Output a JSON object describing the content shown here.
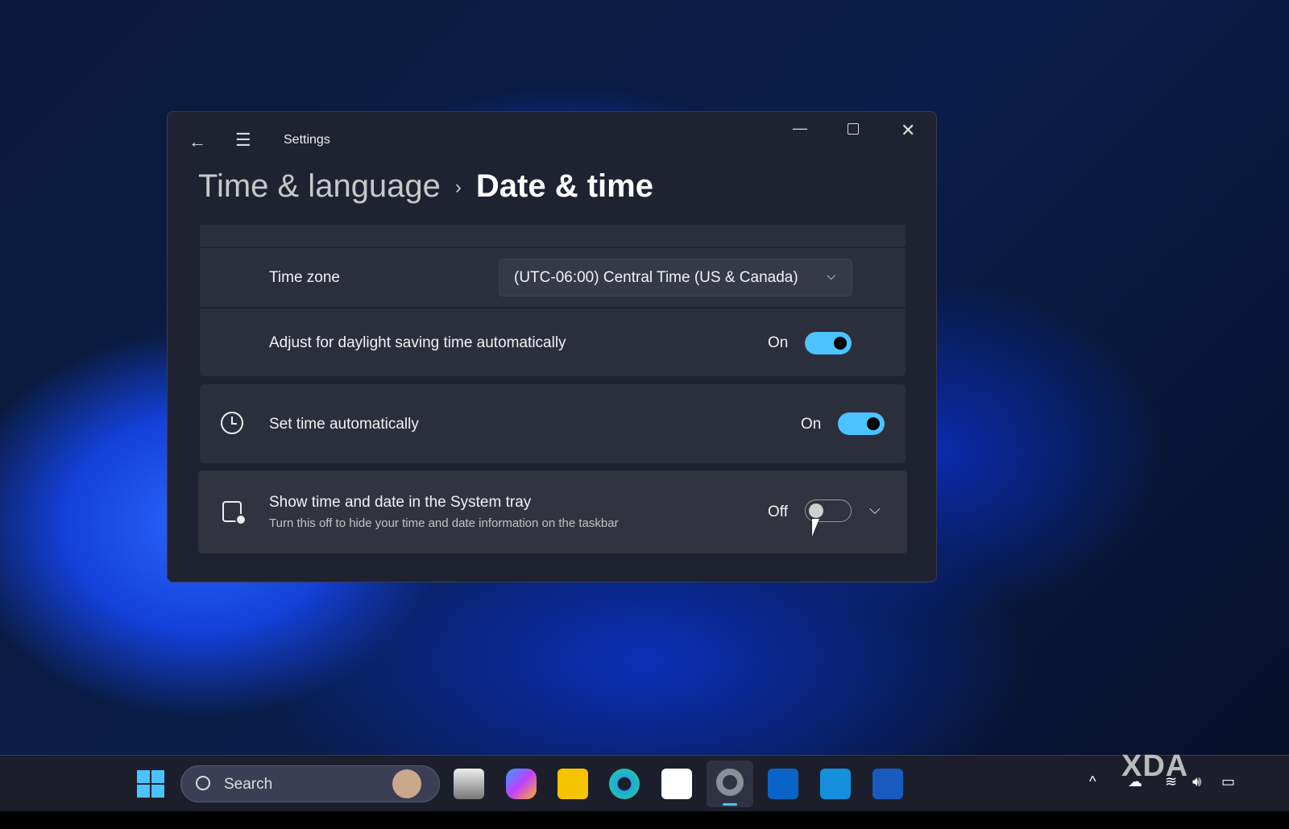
{
  "window": {
    "title": "Settings"
  },
  "breadcrumb": {
    "parent": "Time & language",
    "separator": "›",
    "current": "Date & time"
  },
  "settings": {
    "time_zone": {
      "label": "Time zone",
      "value": "(UTC-06:00) Central Time (US & Canada)"
    },
    "daylight": {
      "label": "Adjust for daylight saving time automatically",
      "state": "On"
    },
    "set_time": {
      "label": "Set time automatically",
      "state": "On"
    },
    "system_tray": {
      "label": "Show time and date in the System tray",
      "description": "Turn this off to hide your time and date information on the taskbar",
      "state": "Off"
    }
  },
  "taskbar": {
    "search_placeholder": "Search",
    "watermark": "XDA"
  },
  "colors": {
    "accent": "#4cc2ff"
  }
}
